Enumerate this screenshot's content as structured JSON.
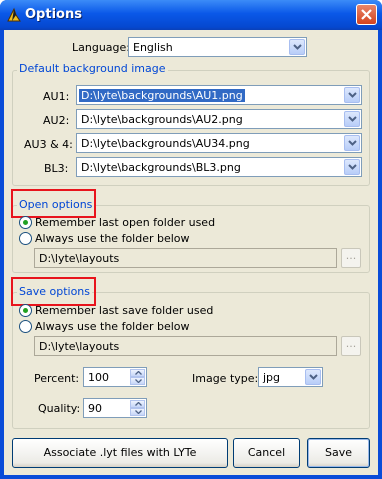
{
  "window": {
    "title": "Options"
  },
  "language": {
    "label": "Language:",
    "value": "English"
  },
  "background": {
    "title": "Default background image",
    "rows": [
      {
        "label": "AU1:",
        "value": "D:\\lyte\\backgrounds\\AU1.png"
      },
      {
        "label": "AU2:",
        "value": "D:\\lyte\\backgrounds\\AU2.png"
      },
      {
        "label": "AU3 & 4:",
        "value": "D:\\lyte\\backgrounds\\AU34.png"
      },
      {
        "label": "BL3:",
        "value": "D:\\lyte\\backgrounds\\BL3.png"
      }
    ]
  },
  "open_options": {
    "title": "Open options",
    "radio_remember": "Remember last open folder used",
    "radio_always": "Always use the folder below",
    "selected": "remember",
    "folder": "D:\\lyte\\layouts",
    "browse_label": "..."
  },
  "save_options": {
    "title": "Save options",
    "radio_remember": "Remember last save folder used",
    "radio_always": "Always use the folder below",
    "selected": "remember",
    "folder": "D:\\lyte\\layouts",
    "browse_label": "...",
    "percent_label": "Percent:",
    "percent_value": "100",
    "image_type_label": "Image type:",
    "image_type_value": "jpg",
    "quality_label": "Quality:",
    "quality_value": "90"
  },
  "buttons": {
    "associate": "Associate .lyt files with LYTe",
    "cancel": "Cancel",
    "save": "Save"
  },
  "colors": {
    "title_bar": "#0a58e8",
    "highlight": "#e8141c",
    "group_title": "#0046d5"
  }
}
